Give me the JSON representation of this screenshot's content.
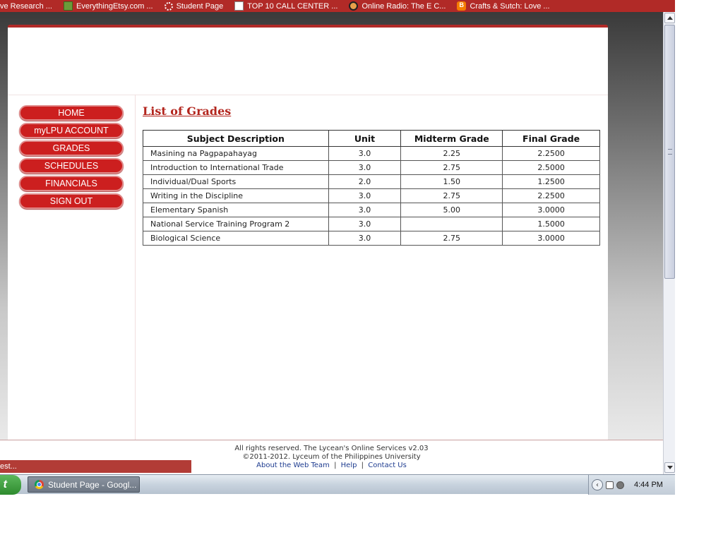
{
  "bookmarks": [
    {
      "label": "ve Research ...",
      "icon": "none"
    },
    {
      "label": "EverythingEtsy.com ...",
      "icon": "green-leaf-icon"
    },
    {
      "label": "Student Page",
      "icon": "loading-icon"
    },
    {
      "label": "TOP 10 CALL CENTER ...",
      "icon": "page-icon"
    },
    {
      "label": "Online Radio: The E C...",
      "icon": "radio-icon"
    },
    {
      "label": "Crafts & Sutch: Love ...",
      "icon": "blogger-icon"
    }
  ],
  "sidebar": {
    "items": [
      {
        "label": "HOME"
      },
      {
        "label": "myLPU ACCOUNT"
      },
      {
        "label": "GRADES"
      },
      {
        "label": "SCHEDULES"
      },
      {
        "label": "FINANCIALS"
      },
      {
        "label": "SIGN OUT"
      }
    ]
  },
  "main": {
    "title": "List of Grades",
    "columns": [
      "Subject Description",
      "Unit",
      "Midterm Grade",
      "Final Grade"
    ],
    "rows": [
      {
        "subject": "Masining na Pagpapahayag",
        "unit": "3.0",
        "midterm": "2.25",
        "final": "2.2500"
      },
      {
        "subject": "Introduction to International Trade",
        "unit": "3.0",
        "midterm": "2.75",
        "final": "2.5000"
      },
      {
        "subject": "Individual/Dual Sports",
        "unit": "2.0",
        "midterm": "1.50",
        "final": "1.2500"
      },
      {
        "subject": "Writing in the Discipline",
        "unit": "3.0",
        "midterm": "2.75",
        "final": "2.2500"
      },
      {
        "subject": "Elementary Spanish",
        "unit": "3.0",
        "midterm": "5.00",
        "final": "3.0000"
      },
      {
        "subject": "National Service Training Program 2",
        "unit": "3.0",
        "midterm": "",
        "final": "1.5000"
      },
      {
        "subject": "Biological Science",
        "unit": "3.0",
        "midterm": "2.75",
        "final": "3.0000"
      }
    ]
  },
  "footer": {
    "line1": "All rights reserved. The Lycean's Online Services v2.03",
    "line2": "©2011-2012. Lyceum of the Philippines University",
    "link_web_team": "About the Web Team",
    "link_help": "Help",
    "link_contact": "Contact Us",
    "separator": "|"
  },
  "notification_bar": {
    "label": "est..."
  },
  "taskbar": {
    "start_label": "t",
    "task_item_label": "Student Page - Googl...",
    "clock": "4:44 PM"
  },
  "colors": {
    "brand_red": "#cc1f1f",
    "title_red": "#b3261e",
    "bookmark_bar": "#b12a27"
  }
}
